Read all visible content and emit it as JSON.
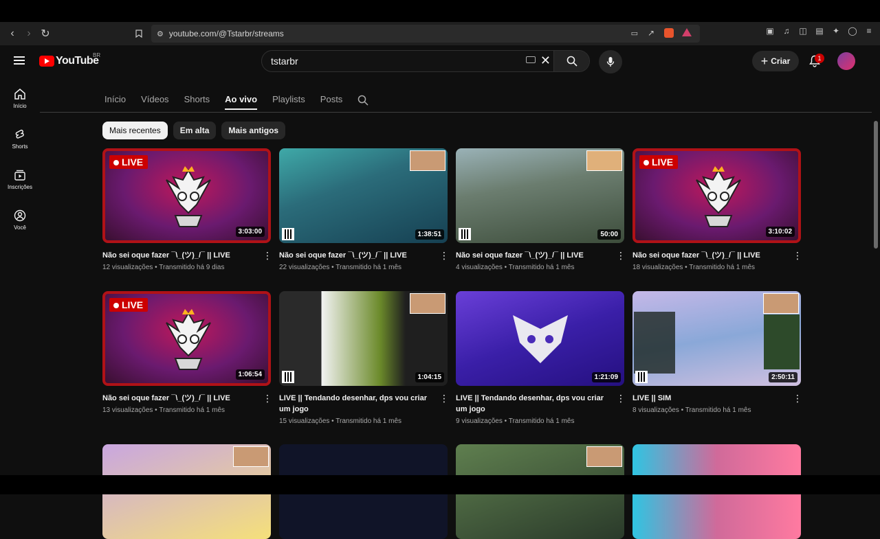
{
  "browser": {
    "url": "youtube.com/@Tstarbr/streams"
  },
  "header": {
    "logo_text": "YouTube",
    "country": "BR",
    "search_value": "tstarbr",
    "create_label": "Criar",
    "notification_count": "1"
  },
  "sidebar": {
    "items": [
      {
        "label": "Início",
        "icon": "home-icon"
      },
      {
        "label": "Shorts",
        "icon": "shorts-icon"
      },
      {
        "label": "Inscrições",
        "icon": "subscriptions-icon"
      },
      {
        "label": "Você",
        "icon": "you-icon"
      }
    ]
  },
  "tabs": [
    "Início",
    "Vídeos",
    "Shorts",
    "Ao vivo",
    "Playlists",
    "Posts"
  ],
  "active_tab": "Ao vivo",
  "chips": [
    "Mais recentes",
    "Em alta",
    "Mais antigos"
  ],
  "videos": [
    {
      "title": "Não sei oque fazer ¯\\_(ツ)_/¯ || LIVE",
      "views": "12 visualizações",
      "when": "Transmitido há 9 dias",
      "duration": "3:03:00",
      "live_label": "LIVE"
    },
    {
      "title": "Não sei oque fazer ¯\\_(ツ)_/¯ || LIVE",
      "views": "22 visualizações",
      "when": "Transmitido há 1 mês",
      "duration": "1:38:51"
    },
    {
      "title": "Não sei oque fazer ¯\\_(ツ)_/¯ || LIVE",
      "views": "4 visualizações",
      "when": "Transmitido há 1 mês",
      "duration": "50:00"
    },
    {
      "title": "Não sei oque fazer ¯\\_(ツ)_/¯ || LIVE",
      "views": "18 visualizações",
      "when": "Transmitido há 1 mês",
      "duration": "3:10:02",
      "live_label": "LIVE"
    },
    {
      "title": "Não sei oque fazer ¯\\_(ツ)_/¯ || LIVE",
      "views": "13 visualizações",
      "when": "Transmitido há 1 mês",
      "duration": "1:06:54",
      "live_label": "LIVE"
    },
    {
      "title": "LIVE || Tendando desenhar, dps vou criar um jogo",
      "views": "15 visualizações",
      "when": "Transmitido há 1 mês",
      "duration": "1:04:15"
    },
    {
      "title": "LIVE || Tendando desenhar, dps vou criar um jogo",
      "views": "9 visualizações",
      "when": "Transmitido há 1 mês",
      "duration": "1:21:09"
    },
    {
      "title": "LIVE || SIM",
      "views": "8 visualizações",
      "when": "Transmitido há 1 mês",
      "duration": "2:50:11"
    }
  ],
  "colors": {
    "background": "#0f0f0f",
    "accent": "#ff0000",
    "live_badge": "#cc0000"
  }
}
